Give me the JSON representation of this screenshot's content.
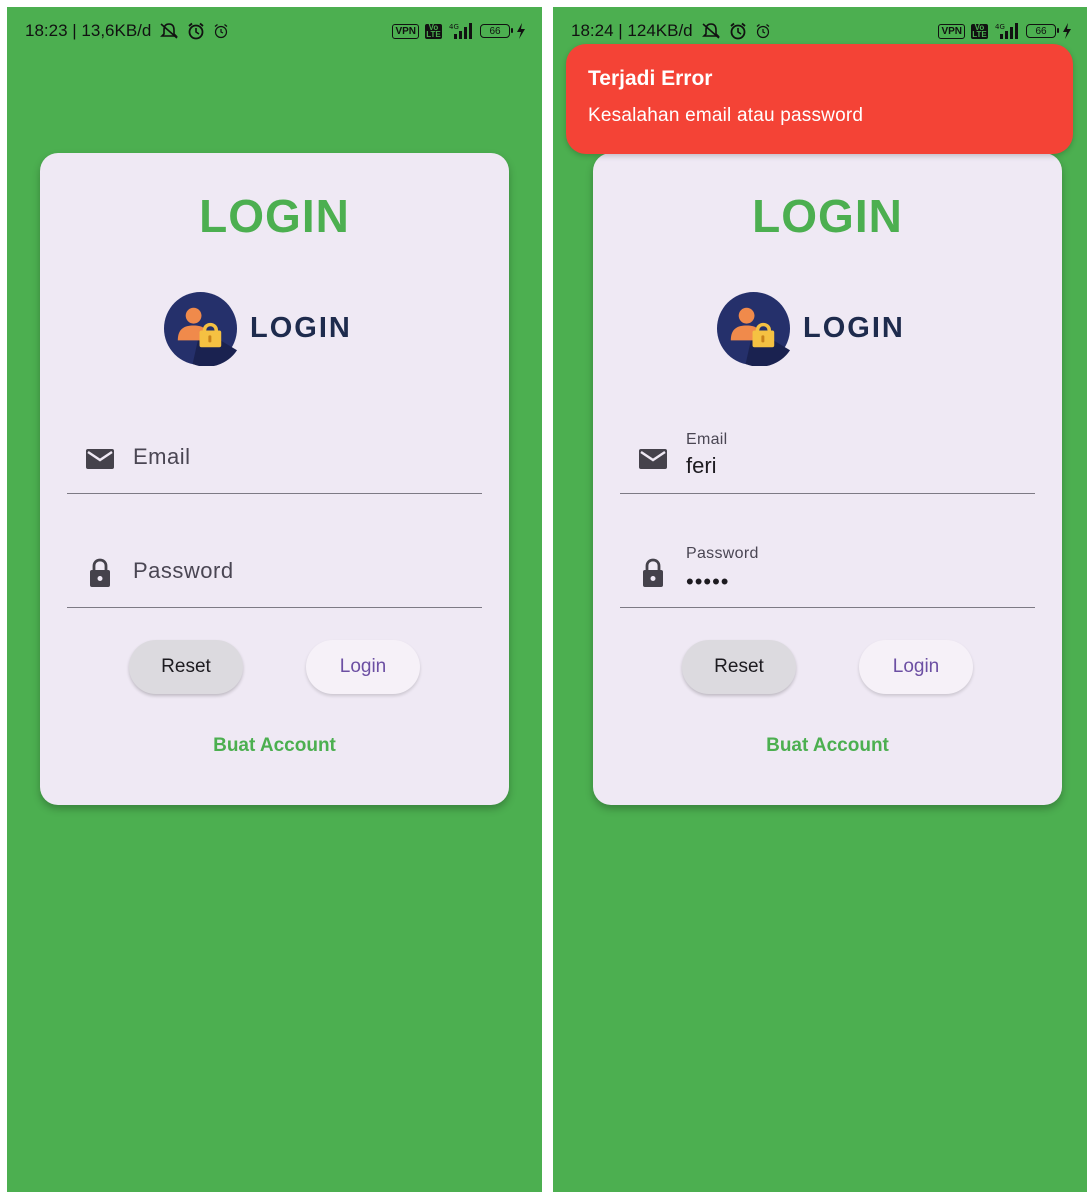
{
  "screens": {
    "before": {
      "status": {
        "time": "18:23 | 13,6KB/d",
        "vpn": "VPN",
        "volte": "Vo LTE",
        "network": "4G",
        "battery": "66"
      },
      "card": {
        "title": "LOGIN",
        "logo_text": "LOGIN",
        "email_placeholder": "Email",
        "password_placeholder": "Password",
        "reset_label": "Reset",
        "login_label": "Login",
        "create_account_label": "Buat Account"
      }
    },
    "after": {
      "status": {
        "time": "18:24 | 124KB/d",
        "vpn": "VPN",
        "volte": "Vo LTE",
        "network": "4G",
        "battery": "66"
      },
      "snackbar": {
        "title": "Terjadi Error",
        "message": "Kesalahan email atau password"
      },
      "card": {
        "title": "LOGIN",
        "logo_text": "LOGIN",
        "email_label": "Email",
        "email_value": "feri",
        "password_label": "Password",
        "password_value": "•••••",
        "reset_label": "Reset",
        "login_label": "Login",
        "create_account_label": "Buat Account"
      }
    }
  },
  "colors": {
    "background": "#4caf50",
    "card": "#efe9f4",
    "accent": "#4caf50",
    "error": "#f44336",
    "login_text": "#6c4fa3"
  },
  "icons": [
    "mail-icon",
    "lock-icon",
    "login-logo-icon",
    "alarm-icon",
    "mute-icon",
    "signal-icon",
    "battery-icon",
    "charging-icon"
  ]
}
